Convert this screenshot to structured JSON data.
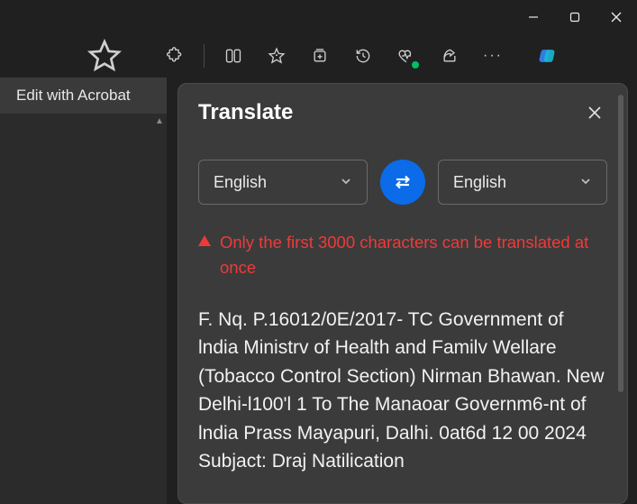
{
  "toolbar": {
    "icons": {
      "favorite": "star-icon",
      "extensions": "puzzle-icon",
      "split": "split-screen-icon",
      "favorites": "favorites-star-plus-icon",
      "collections": "collections-icon",
      "history": "history-icon",
      "performance": "heart-pulse-icon",
      "share": "share-icon",
      "more": "···",
      "copilot": "copilot-icon"
    }
  },
  "left": {
    "acrobat_label": "Edit with Acrobat"
  },
  "panel": {
    "title": "Translate",
    "source_lang": "English",
    "target_lang": "English",
    "warning": "Only the first 3000 characters can be translated at once",
    "body": "F. Nq. P.16012/0E/2017- TC Government of lndia Ministrv of Health and Familv Wellare (Tobacco Control Section) Nirman Bhawan. New Delhi-l100'l 1 To The Manaoar Governm6-nt of lndia Prass Mayapuri, Dalhi. 0at6d 12 00 2024 Subjact: Draj Natilication"
  }
}
